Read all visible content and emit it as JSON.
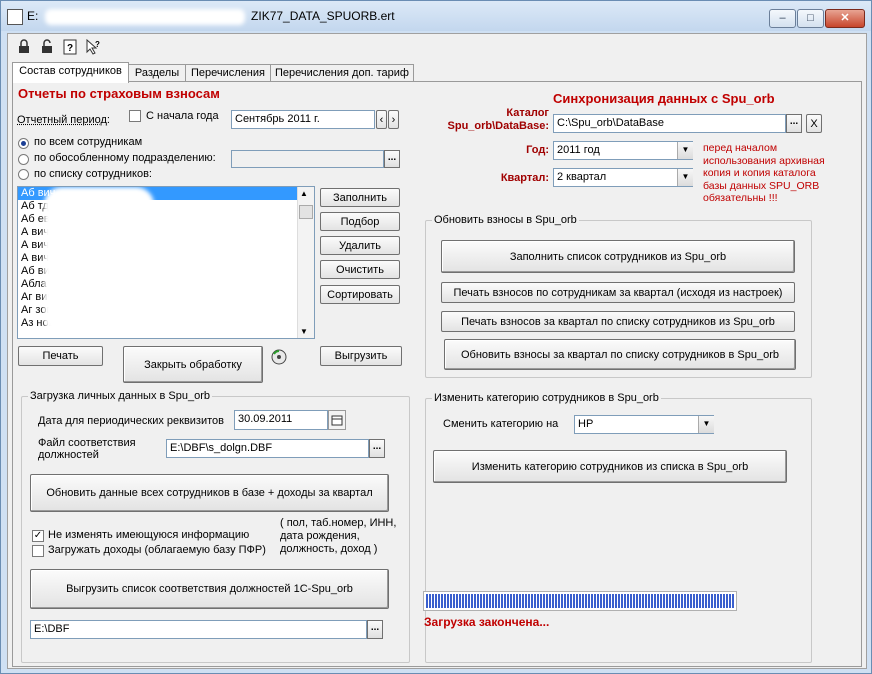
{
  "window": {
    "title_prefix": "E:",
    "title_suffix": "ZIK77_DATA_SPUORB.ert",
    "minimize": "–",
    "maximize": "□",
    "close": "✕"
  },
  "toolbar": {
    "icons": [
      "lock-icon",
      "unlock-icon",
      "help-icon",
      "pointer-help-icon"
    ]
  },
  "tabs": [
    {
      "label": "Состав сотрудников",
      "active": true
    },
    {
      "label": "Разделы",
      "active": false
    },
    {
      "label": "Перечисления",
      "active": false
    },
    {
      "label": "Перечисления доп. тариф",
      "active": false
    }
  ],
  "left": {
    "header": "Отчеты по страховым взносам",
    "period_label": "Отчетный период:",
    "from_year_label": "С начала года",
    "from_year_checked": false,
    "period_value": "Сентябрь 2011 г.",
    "prev": "‹",
    "next": "›",
    "radio_all": "по всем сотрудникам",
    "radio_unit": "по обособленному подразделению:",
    "radio_list": "по списку сотрудников:",
    "selected_radio": "all",
    "employees": [
      "Аб вич",
      "Аб тдинович",
      "Аб евич",
      "А вич",
      "А вич",
      "А вич",
      "Аб вич",
      "Абла вич",
      "Аг вич",
      "Аг зович",
      "Аз нович"
    ],
    "buttons": {
      "fill": "Заполнить",
      "select": "Подбор",
      "delete": "Удалить",
      "clear": "Очистить",
      "sort": "Сортировать",
      "print": "Печать",
      "close": "Закрыть обработку",
      "export": "Выгрузить"
    }
  },
  "load": {
    "group_label": "Загрузка личных данных в Spu_orb",
    "date_label": "Дата для периодических реквизитов",
    "date_value": "30.09.2011",
    "file_label": "Файл соответствия должностей",
    "file_value": "E:\\DBF\\s_dolgn.DBF",
    "update_button": "Обновить данные всех сотрудников в базе + доходы за квартал",
    "keep_info_label": "Не изменять имеющуюся информацию",
    "keep_info_checked": true,
    "load_income_label": "Загружать доходы (облагаемую базу ПФР)",
    "load_income_checked": false,
    "fields_note": "( пол, таб.номер, ИНН, дата рождения, должность, доход )",
    "export_positions_button": "Выгрузить список соответствия должностей 1С-Spu_orb",
    "folder_value": "E:\\DBF"
  },
  "sync": {
    "header": "Синхронизация данных с Spu_orb",
    "catalog_label_1": "Каталог",
    "catalog_label_2": "Spu_orb\\DataBase:",
    "catalog_value": "C:\\Spu_orb\\DataBase",
    "year_label": "Год:",
    "year_value": "2011 год",
    "quarter_label": "Квартал:",
    "quarter_value": "2 квартал",
    "warning": "перед началом использования архивная копия и копия каталога базы данных SPU_ORB обязательны !!!",
    "clear": "X"
  },
  "update": {
    "group_label": "Обновить взносы в Spu_orb",
    "fill_button": "Заполнить список сотрудников из Spu_orb",
    "print_employees_button": "Печать взносов по сотрудникам за квартал (исходя из настроек)",
    "print_list_button": "Печать взносов за квартал по списку сотрудников из Spu_orb",
    "update_button": "Обновить взносы за квартал по списку сотрудников в Spu_orb"
  },
  "category": {
    "group_label": "Изменить категорию сотрудников в Spu_orb",
    "change_label": "Сменить категорию на",
    "value": "НР",
    "button": "Изменить категорию сотрудников из списка в Spu_orb"
  },
  "status": {
    "progress": 1.0,
    "text": "Загрузка закончена..."
  }
}
